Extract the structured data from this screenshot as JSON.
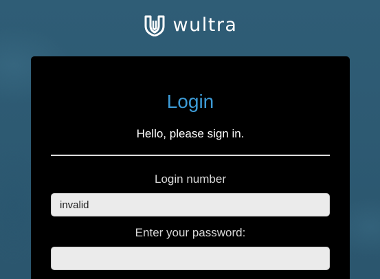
{
  "brand": {
    "name": "wultra",
    "logo_icon": "wultra-shield-icon",
    "text_color": "#ffffff"
  },
  "login_card": {
    "title": "Login",
    "title_color": "#3d9bd6",
    "subtitle": "Hello, please sign in.",
    "login_number": {
      "label": "Login number",
      "value": "invalid"
    },
    "password": {
      "label": "Enter your password:",
      "value": ""
    }
  }
}
